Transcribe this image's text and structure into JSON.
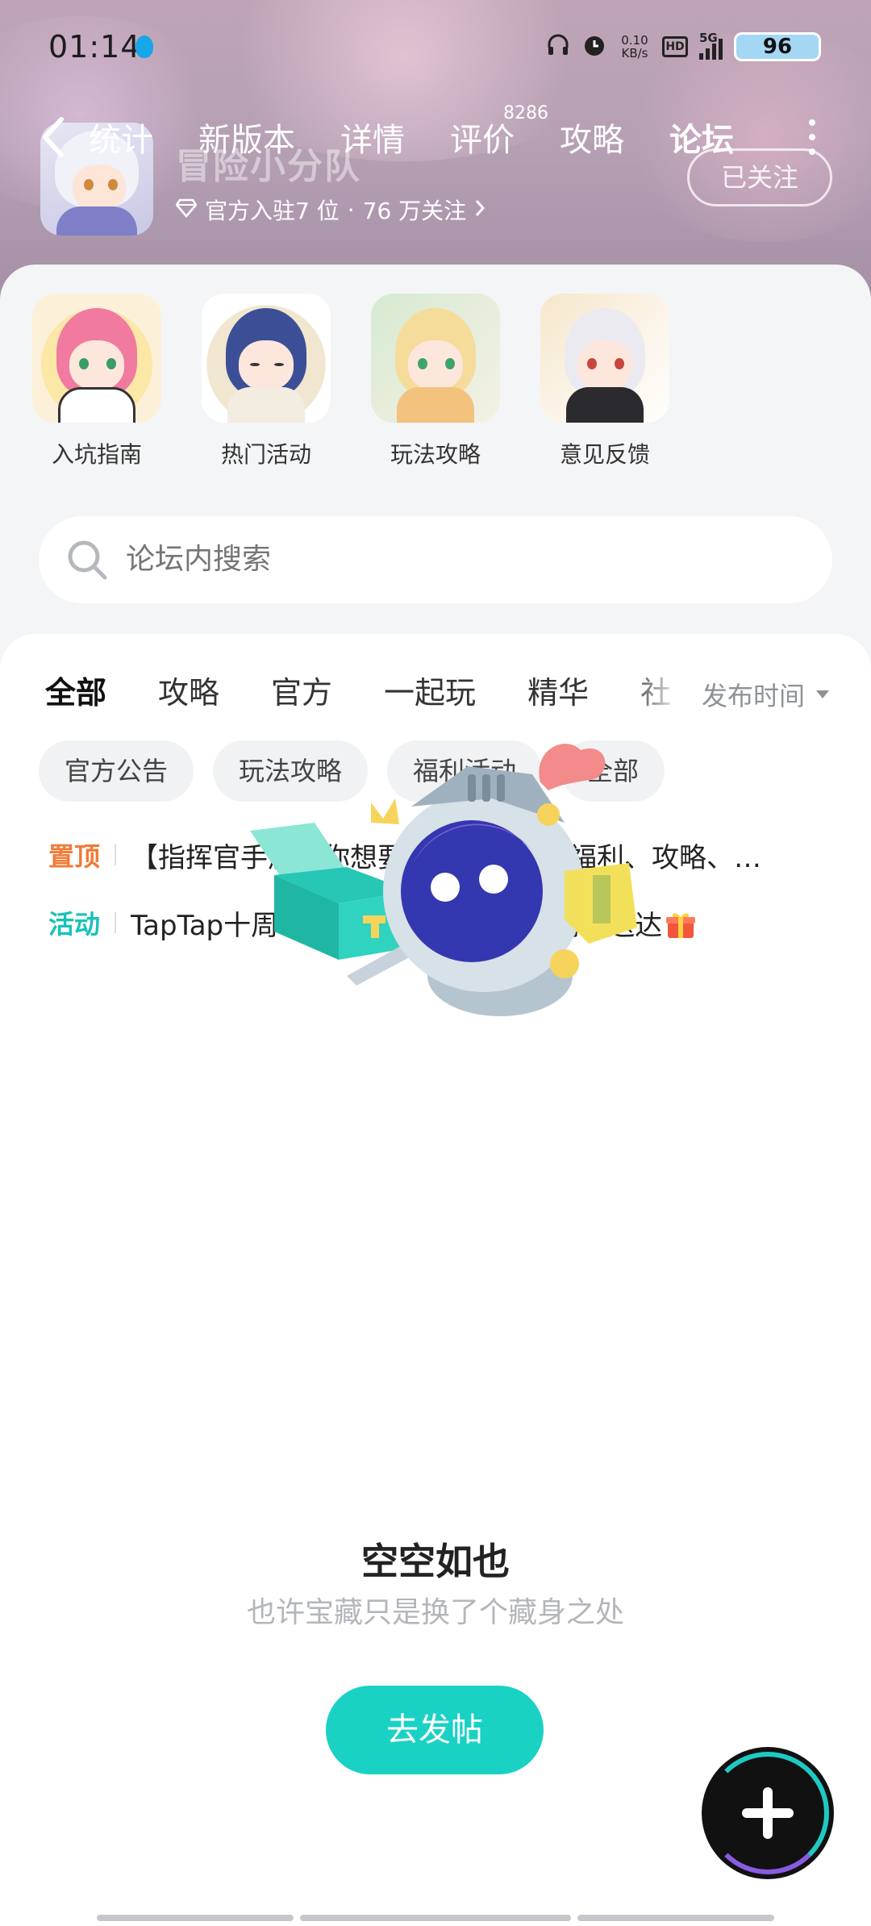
{
  "status_bar": {
    "time": "01:14",
    "speed_top": "0.10",
    "speed_unit": "KB/s",
    "hd": "HD",
    "network": "5G",
    "battery": "96"
  },
  "game": {
    "title": "冒险小分队",
    "meta_verified": "官方入驻7 位",
    "meta_dot": "·",
    "meta_followers": "76 万关注",
    "follow_label": "已关注"
  },
  "nav": {
    "tabs": [
      {
        "label": "统计"
      },
      {
        "label": "新版本"
      },
      {
        "label": "详情"
      },
      {
        "label": "评价"
      },
      {
        "label": "攻略"
      },
      {
        "label": "论坛"
      }
    ],
    "review_count": "8286",
    "active_index": 5
  },
  "quick_nav": [
    {
      "label": "入坑指南"
    },
    {
      "label": "热门活动"
    },
    {
      "label": "玩法攻略"
    },
    {
      "label": "意见反馈"
    }
  ],
  "search": {
    "placeholder": "论坛内搜索"
  },
  "category_tabs": [
    {
      "label": "全部"
    },
    {
      "label": "攻略"
    },
    {
      "label": "官方"
    },
    {
      "label": "一起玩"
    },
    {
      "label": "精华"
    },
    {
      "label": "社"
    }
  ],
  "sort_label": "发布时间",
  "filter_chips": [
    {
      "label": "官方公告"
    },
    {
      "label": "玩法攻略"
    },
    {
      "label": "福利活动"
    },
    {
      "label": "全部"
    }
  ],
  "pinned": [
    {
      "tag": "置顶",
      "text": "【指挥官手册】你想要的这里都有！福利、攻略、…",
      "color": "#f07a36"
    },
    {
      "tag": "活动",
      "text": "TapTap十周年庆典开启！十年陪伴谢礼送达",
      "color": "#19c2b8"
    }
  ],
  "empty_state": {
    "title": "空空如也",
    "subtitle": "也许宝藏只是换了个藏身之处",
    "button": "去发帖"
  },
  "colors": {
    "accent": "#19d2c4",
    "pin_top": "#f07a36",
    "pin_event": "#19c2b8"
  },
  "icons": [
    "back-arrow-icon",
    "more-icon",
    "search-icon",
    "sort-caret-icon",
    "gift-icon",
    "plus-icon",
    "diamond-icon",
    "chevron-right-icon"
  ]
}
